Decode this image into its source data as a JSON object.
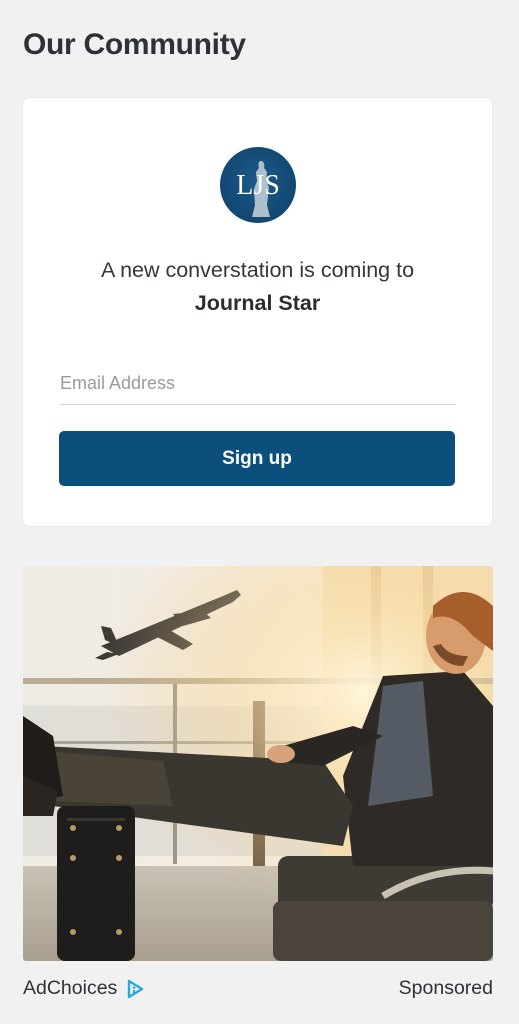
{
  "page": {
    "title": "Our Community"
  },
  "signup_card": {
    "logo_text": "LJS",
    "tagline_line1": "A new converstation is coming to",
    "tagline_line2": "Journal Star",
    "email_placeholder": "Email Address",
    "email_value": "",
    "signup_label": "Sign up"
  },
  "ad": {
    "image_description_icon": "travel-photo",
    "adchoices_label": "AdChoices",
    "sponsored_label": "Sponsored"
  },
  "colors": {
    "primary_button": "#0d4f7c",
    "logo_bg": "#134a74",
    "page_bg": "#f1f1f1",
    "adchoices_icon": "#29a8e0"
  }
}
